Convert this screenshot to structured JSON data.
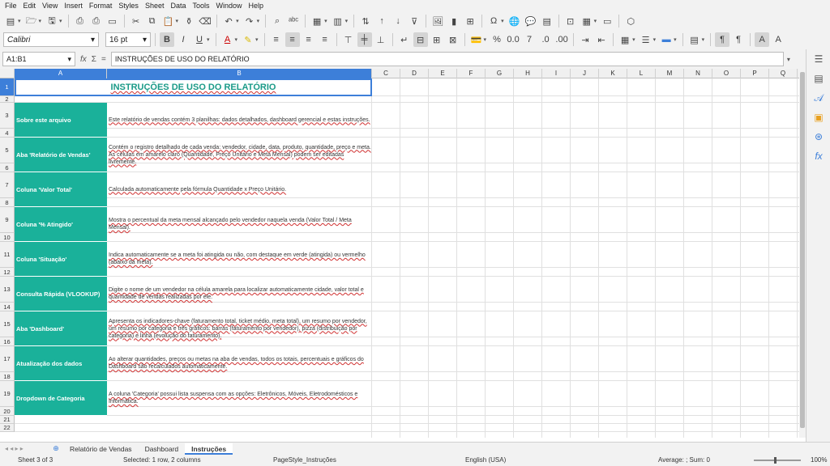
{
  "menu": [
    "File",
    "Edit",
    "View",
    "Insert",
    "Format",
    "Styles",
    "Sheet",
    "Data",
    "Tools",
    "Window",
    "Help"
  ],
  "format_bar": {
    "font_name": "Calibri",
    "font_size": "16 pt"
  },
  "formula_bar": {
    "cell_ref": "A1:B1",
    "fx": "fx",
    "sum": "Σ",
    "equals": "=",
    "content": "INSTRUÇÕES DE USO DO RELATÓRIO"
  },
  "columns": [
    "A",
    "B",
    "C",
    "D",
    "E",
    "F",
    "G",
    "H",
    "I",
    "J",
    "K",
    "L",
    "M",
    "N",
    "O",
    "P",
    "Q"
  ],
  "rows": [
    "1",
    "2",
    "3",
    "4",
    "5",
    "6",
    "7",
    "8",
    "9",
    "10",
    "11",
    "12",
    "13",
    "14",
    "15",
    "16",
    "17",
    "18",
    "19",
    "20",
    "21",
    "22"
  ],
  "title": "INSTRUÇÕES DE USO DO RELATÓRIO",
  "sections": [
    {
      "label": "Sobre este arquivo",
      "text": "Este relatório de vendas contém 3 planilhas: dados detalhados, dashboard gerencial e estas instruções."
    },
    {
      "label": "Aba 'Relatório de Vendas'",
      "text": "Contém o registro detalhado de cada venda: vendedor, cidade, data, produto, quantidade, preço e meta. As células em amarelo claro (Quantidade, Preço Unitário e Meta Mensal) podem ser editadas livremente."
    },
    {
      "label": "Coluna 'Valor Total'",
      "text": "Calculada automaticamente pela fórmula Quantidade x Preço Unitário."
    },
    {
      "label": "Coluna '% Atingido'",
      "text": "Mostra o percentual da meta mensal alcançado pelo vendedor naquela venda (Valor Total / Meta Mensal)."
    },
    {
      "label": "Coluna 'Situação'",
      "text": "Indica automaticamente se a meta foi atingida ou não, com destaque em verde (atingida) ou vermelho (abaixo da meta)."
    },
    {
      "label": "Consulta Rápida (VLOOKUP)",
      "text": "Digite o nome de um vendedor na célula amarela para localizar automaticamente cidade, valor total e quantidade de vendas realizadas por ele."
    },
    {
      "label": "Aba 'Dashboard'",
      "text": "Apresenta os indicadores-chave (faturamento total, ticket médio, meta total), um resumo por vendedor, um resumo por categoria e três gráficos: barras (faturamento por vendedor), pizza (distribuição por categoria) e linha (evolução do faturamento)."
    },
    {
      "label": "Atualização dos dados",
      "text": "Ao alterar quantidades, preços ou metas na aba de vendas, todos os totais, percentuais e gráficos do Dashboard são recalculados automaticamente."
    },
    {
      "label": "Dropdown de Categoria",
      "text": "A coluna 'Categoria' possui lista suspensa com as opções: Eletrônicos, Móveis, Eletrodomésticos e Informática."
    }
  ],
  "tabs": [
    "Relatório de Vendas",
    "Dashboard",
    "Instruções"
  ],
  "active_tab": "Instruções",
  "status": {
    "sheet": "Sheet 3 of 3",
    "selection": "Selected: 1 row, 2 columns",
    "page_style": "PageStyle_Instruções",
    "language": "English (USA)",
    "summary": "Average: ; Sum: 0",
    "zoom": "100%"
  },
  "colors": {
    "accent": "#3d7fd9",
    "label_bg": "#1ab19a",
    "title_text": "#1a9a88"
  }
}
